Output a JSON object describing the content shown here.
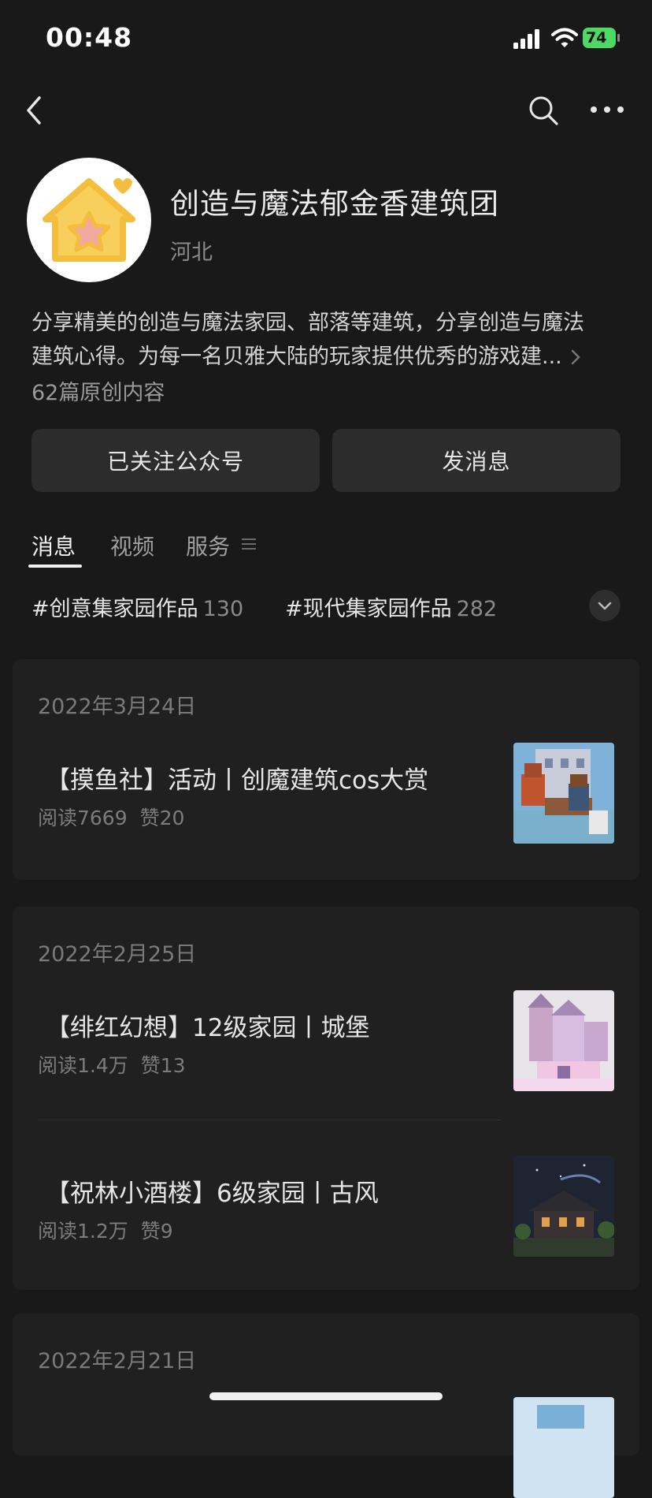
{
  "status_bar": {
    "time": "00:48",
    "battery": "74"
  },
  "profile": {
    "name": "创造与魔法郁金香建筑团",
    "region": "河北",
    "description_line1": "分享精美的创造与魔法家园、部落等建筑，分享创造与魔法",
    "description_line2": "建筑心得。为每一名贝雅大陆的玩家提供优秀的游戏建...",
    "original_count": "62篇原创内容"
  },
  "buttons": {
    "follow": "已关注公众号",
    "message": "发消息"
  },
  "tabs": [
    "消息",
    "视频",
    "服务"
  ],
  "topics": [
    {
      "label": "#创意集家园作品",
      "count": "130"
    },
    {
      "label": "#现代集家园作品",
      "count": "282"
    }
  ],
  "cards": [
    {
      "date": "2022年3月24日",
      "articles": [
        {
          "title": "【摸鱼社】活动丨创魔建筑cos大赏",
          "reads": "阅读7669",
          "likes": "赞20"
        }
      ]
    },
    {
      "date": "2022年2月25日",
      "articles": [
        {
          "title": "【绯红幻想】12级家园丨城堡",
          "reads": "阅读1.4万",
          "likes": "赞13"
        },
        {
          "title": "【祝林小酒楼】6级家园丨古风",
          "reads": "阅读1.2万",
          "likes": "赞9"
        }
      ]
    },
    {
      "date": "2022年2月21日",
      "articles": []
    }
  ],
  "colors": {
    "background": "#191919",
    "card": "#202020",
    "button": "#2c2c2c",
    "battery": "#4cd964"
  }
}
